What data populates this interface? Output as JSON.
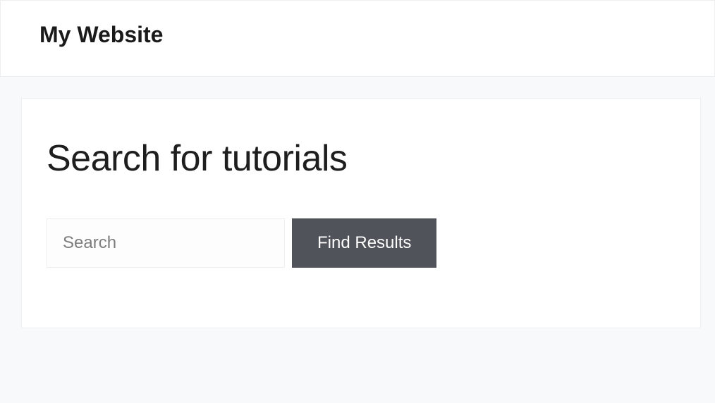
{
  "header": {
    "site_title": "My Website"
  },
  "main": {
    "heading": "Search for tutorials",
    "search": {
      "placeholder": "Search",
      "value": "",
      "button_label": "Find Results"
    }
  },
  "colors": {
    "page_bg": "#f8f9fa",
    "card_bg": "#ffffff",
    "button_bg": "#51535a",
    "button_text": "#ffffff",
    "border": "#eeeeee"
  }
}
